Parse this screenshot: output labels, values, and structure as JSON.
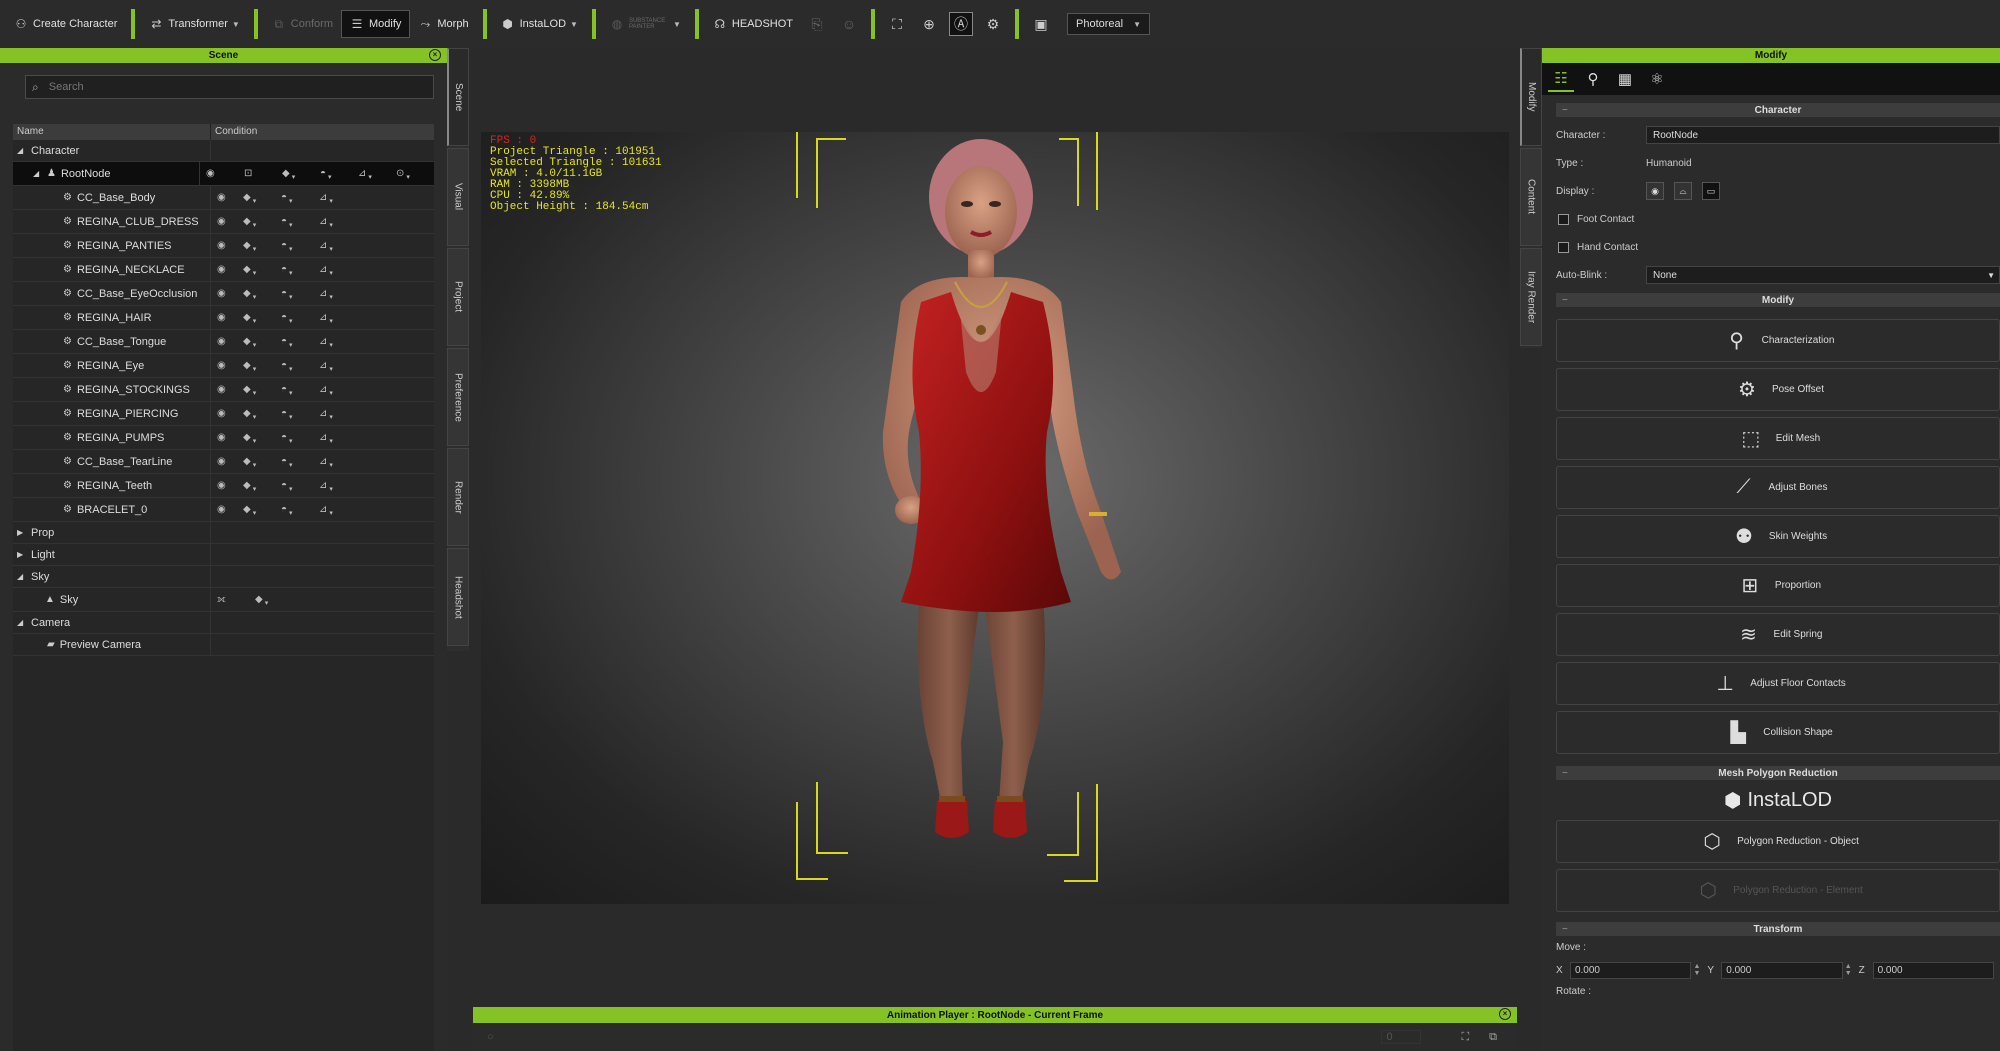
{
  "toolbar": {
    "create_character": "Create Character",
    "transformer": "Transformer",
    "conform": "Conform",
    "modify": "Modify",
    "morph": "Morph",
    "instalod": "InstaLOD",
    "substance": "SUBSTANCE PAINTER",
    "headshot": "HEADSHOT",
    "render_mode": "Photoreal"
  },
  "scene": {
    "title": "Scene",
    "search_placeholder": "Search",
    "col_name": "Name",
    "col_condition": "Condition",
    "groups": {
      "character": "Character",
      "rootnode": "RootNode",
      "prop": "Prop",
      "light": "Light",
      "sky": "Sky",
      "sky_item": "Sky",
      "camera": "Camera",
      "preview_camera": "Preview Camera"
    },
    "objects": [
      "CC_Base_Body",
      "REGINA_CLUB_DRESS",
      "REGINA_PANTIES",
      "REGINA_NECKLACE",
      "CC_Base_EyeOcclusion",
      "REGINA_HAIR",
      "CC_Base_Tongue",
      "REGINA_Eye",
      "REGINA_STOCKINGS",
      "REGINA_PIERCING",
      "REGINA_PUMPS",
      "CC_Base_TearLine",
      "REGINA_Teeth",
      "BRACELET_0"
    ]
  },
  "left_tabs": [
    "Scene",
    "Visual",
    "Project",
    "Preference",
    "Render",
    "Headshot"
  ],
  "right_tabs": [
    "Modify",
    "Content",
    "Iray Render"
  ],
  "viewport": {
    "fps": "FPS : 0",
    "project_triangle": "Project Triangle : 101951",
    "selected_triangle": "Selected Triangle : 101631",
    "vram": "VRAM : 4.0/11.1GB",
    "ram": "RAM : 3398MB",
    "cpu": "CPU : 42.89%",
    "object_height": "Object Height : 184.54cm"
  },
  "anim_player": {
    "title": "Animation Player : RootNode - Current Frame",
    "frame": "0"
  },
  "modify": {
    "title": "Modify",
    "character_section": "Character",
    "character_label": "Character :",
    "character_value": "RootNode",
    "type_label": "Type :",
    "type_value": "Humanoid",
    "display_label": "Display :",
    "foot_contact": "Foot Contact",
    "hand_contact": "Hand Contact",
    "auto_blink_label": "Auto-Blink :",
    "auto_blink_value": "None",
    "modify_section": "Modify",
    "buttons": {
      "characterization": "Characterization",
      "pose_offset": "Pose Offset",
      "edit_mesh": "Edit Mesh",
      "adjust_bones": "Adjust Bones",
      "skin_weights": "Skin Weights",
      "proportion": "Proportion",
      "edit_spring": "Edit Spring",
      "adjust_floor": "Adjust Floor Contacts",
      "collision_shape": "Collision Shape"
    },
    "mesh_section": "Mesh Polygon Reduction",
    "instalod_logo": "InstaLOD",
    "poly_object": "Polygon Reduction - Object",
    "poly_element": "Polygon Reduction - Element",
    "transform_section": "Transform",
    "move_label": "Move :",
    "rotate_label": "Rotate :",
    "x_label": "X",
    "y_label": "Y",
    "z_label": "Z",
    "x_value": "0.000",
    "y_value": "0.000",
    "z_value": "0.000"
  },
  "colors": {
    "accent": "#84c225",
    "stats_text": "#e6e61e",
    "fps_text": "#e02020",
    "dress": "#b01a1a"
  }
}
